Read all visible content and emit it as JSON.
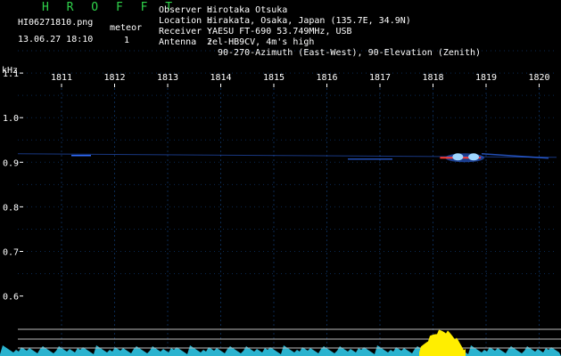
{
  "header": {
    "brand": "H R O F F T",
    "filename": "HI06271810.png",
    "datetime": "13.06.27 18:10",
    "meteor_label": "meteor",
    "meteor_count": "1"
  },
  "station": {
    "observer_key": "Observer :",
    "observer": "Hirotaka Otsuka",
    "location_key": "Location :",
    "location": "Hirakata, Osaka, Japan (135.7E, 34.9N)",
    "receiver_key": "Receiver :",
    "receiver": "YAESU FT-690 53.749MHz, USB",
    "antenna_key": "Antenna  :",
    "antenna_line1": "2el-HB9CV, 4m's high",
    "antenna_line2": "90-270-Azimuth (East-West), 90-Elevation (Zenith)"
  },
  "chart_data": {
    "type": "heatmap",
    "y_unit_label": "kHz",
    "x_ticks": [
      "1811",
      "1812",
      "1813",
      "1814",
      "1815",
      "1816",
      "1817",
      "1818",
      "1819",
      "1820"
    ],
    "y_ticks": [
      "1.1",
      "1.0",
      "0.9",
      "0.8",
      "0.7",
      "0.6"
    ],
    "ylim": [
      0.58,
      1.18
    ],
    "carrier_khz": 0.915,
    "meteor_echo": {
      "start": "1818.3",
      "end": "1818.9",
      "frequency_khz": 0.91
    },
    "colors": {
      "background": "#000000",
      "grid": "#0b2a52",
      "echo_core": "#ff3b30",
      "echo_halo": "#2f6dff",
      "noise": "#2fc7e6",
      "burst": "#ffee00",
      "reference_line": "#bcbcbc"
    }
  }
}
